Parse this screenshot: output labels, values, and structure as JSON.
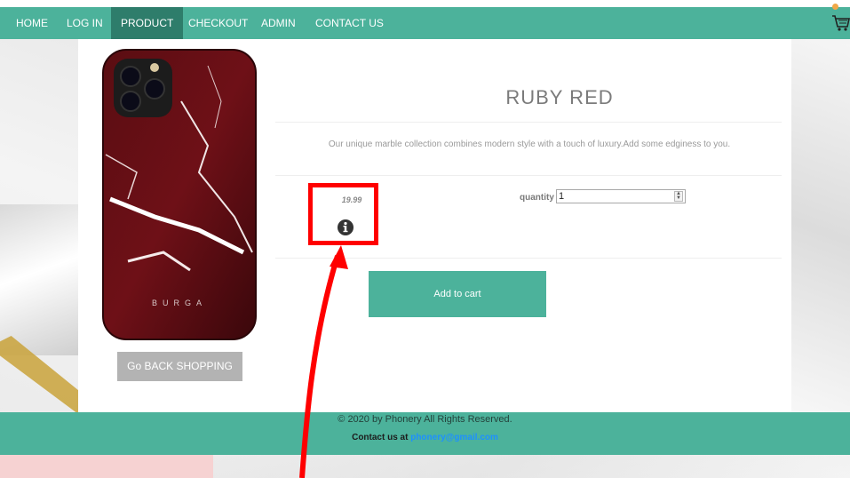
{
  "nav": {
    "items": [
      {
        "label": "HOME"
      },
      {
        "label": "LOG IN"
      },
      {
        "label": "PRODUCT"
      },
      {
        "label": "CHECKOUT"
      },
      {
        "label": "ADMIN"
      },
      {
        "label": "CONTACT US"
      }
    ],
    "active": "PRODUCT",
    "cart_icon": "shopping-cart-icon"
  },
  "product": {
    "title": "RUBY RED",
    "description": "Our unique marble collection combines modern style with a touch of luxury.Add some edginess to you.",
    "image_brand_text": "BURGA",
    "price": "19.99",
    "info_icon": "info-circle-icon",
    "quantity_label": "quantity",
    "quantity_value": "1",
    "add_to_cart_label": "Add to cart",
    "back_label": "Go BACK SHOPPING"
  },
  "footer": {
    "copyright": "© 2020 by Phonery All Rights Reserved.",
    "contact_prefix": "Contact us at ",
    "contact_email": "phonery@gmail.com"
  },
  "colors": {
    "brand_teal": "#4cb29b",
    "nav_active": "#2e7d6b",
    "highlight_red": "#ff0000",
    "link_blue": "#1e90ff"
  }
}
